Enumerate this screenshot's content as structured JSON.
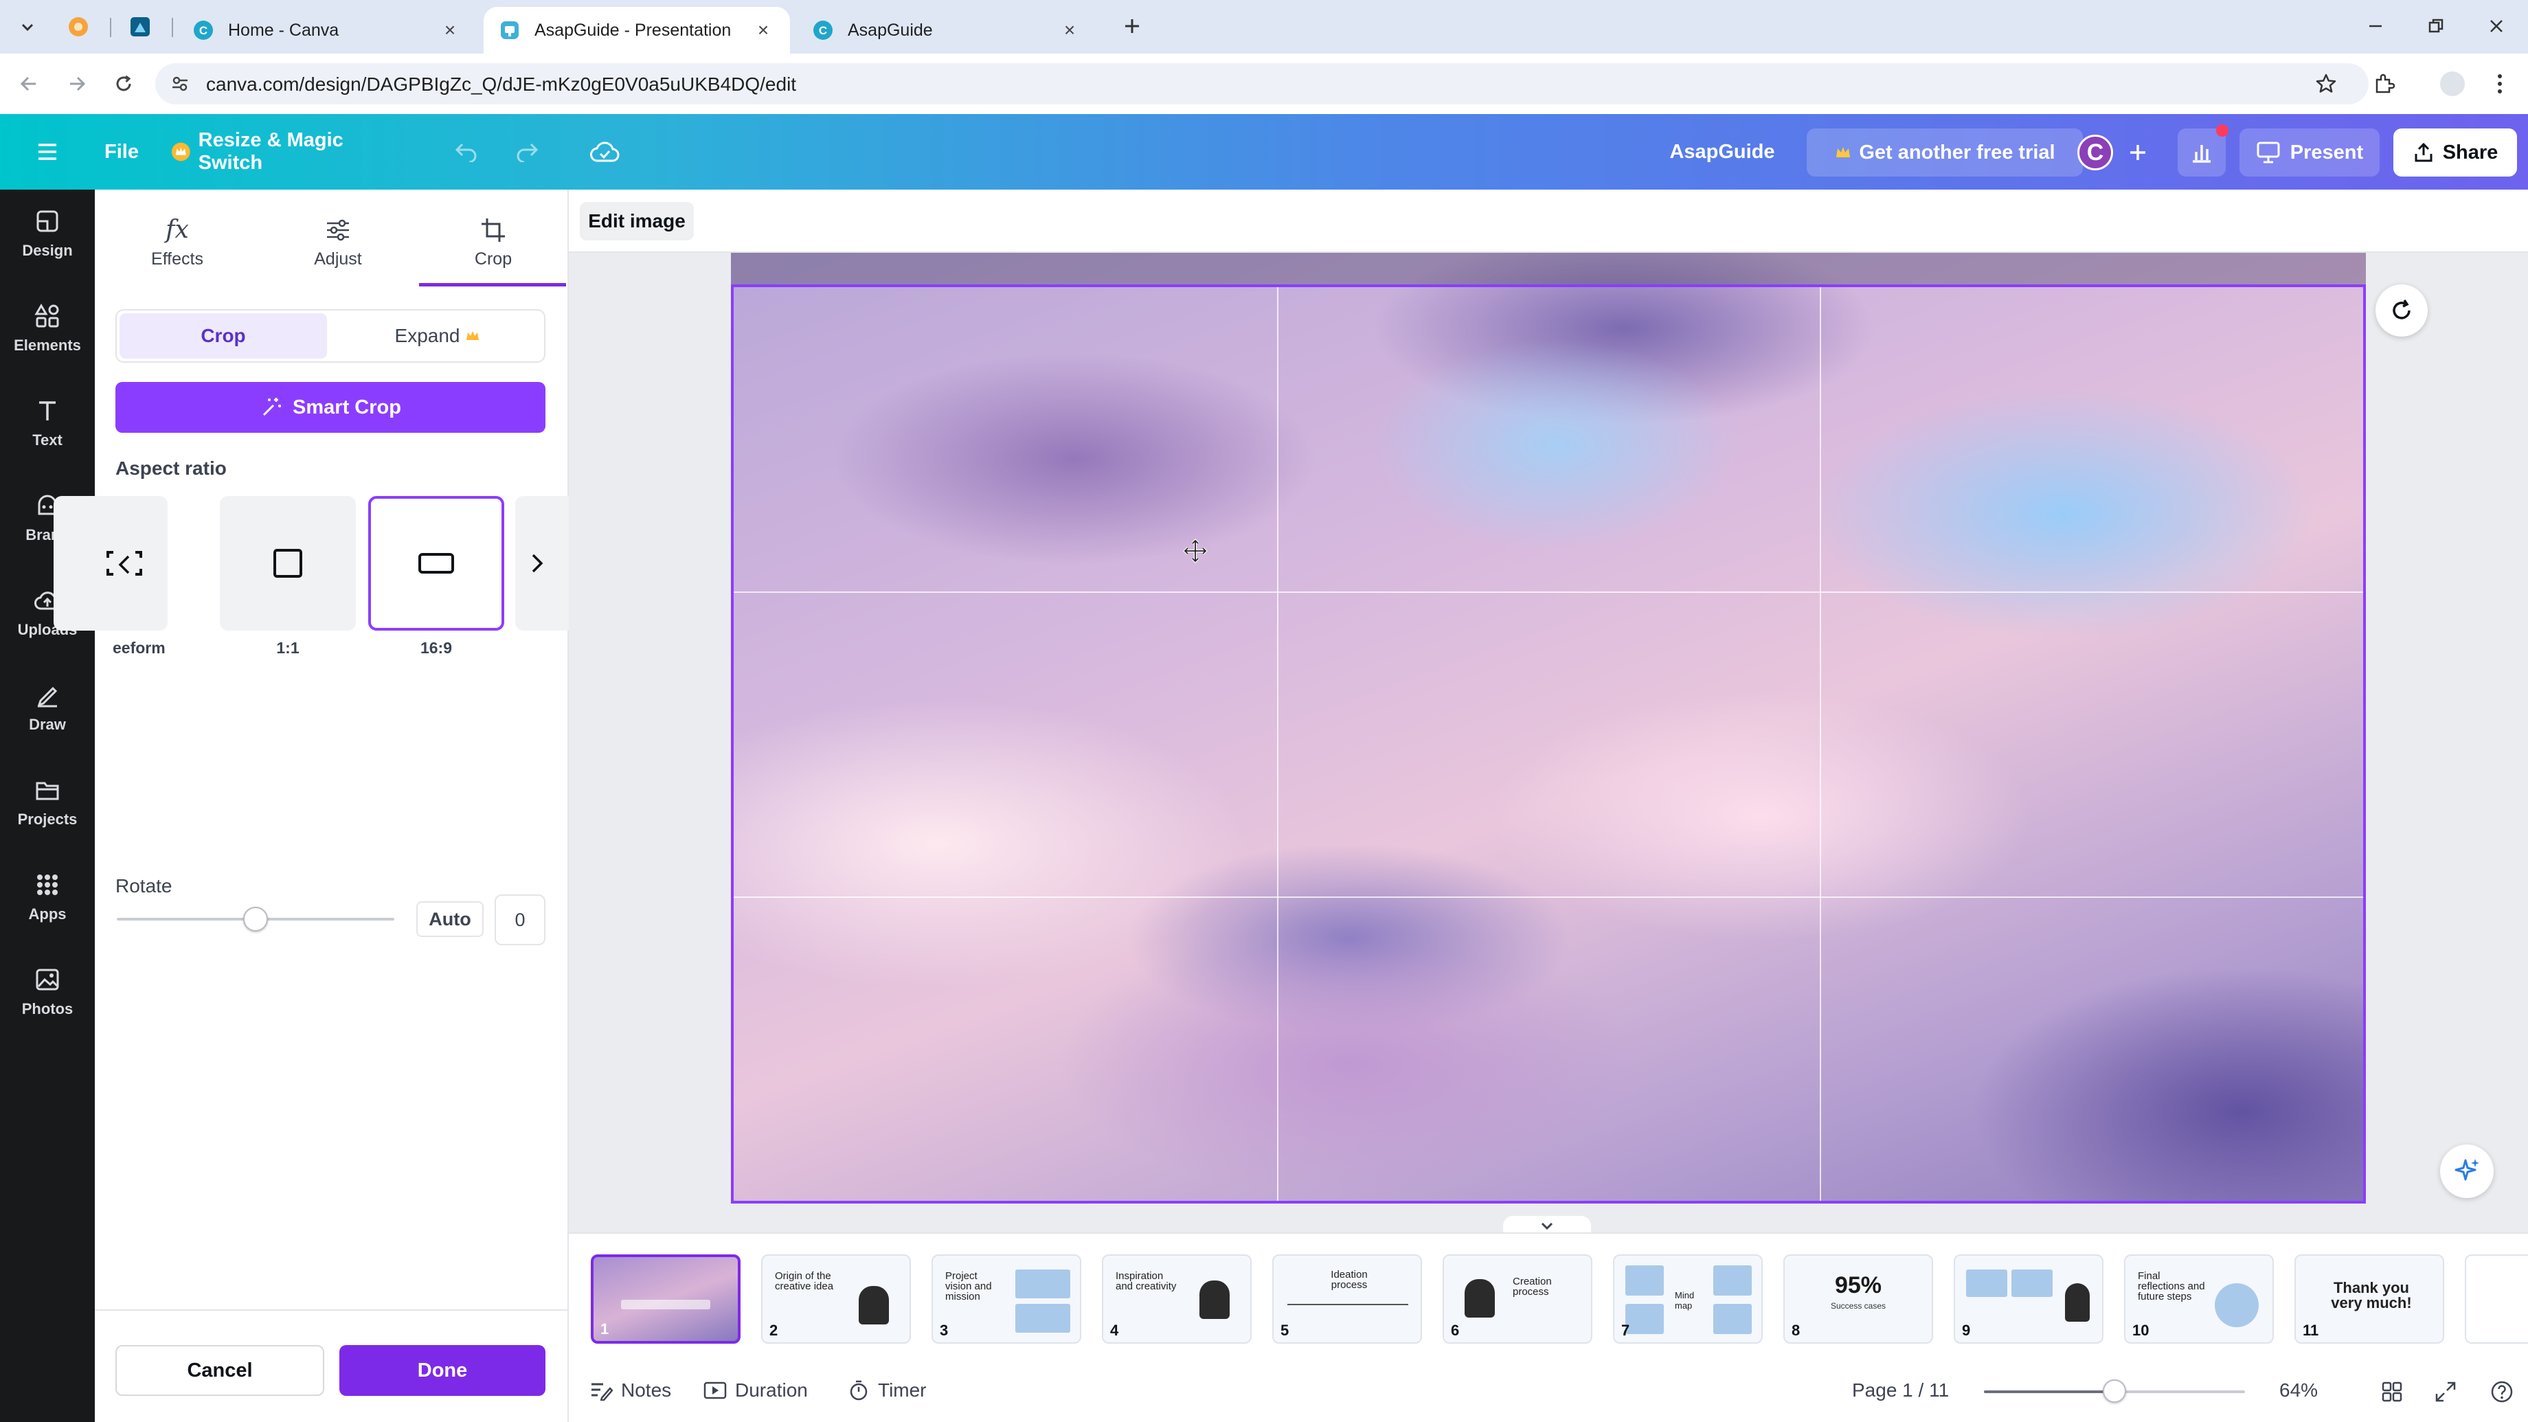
{
  "browser": {
    "tabs": [
      {
        "label": "Home - Canva"
      },
      {
        "label": "AsapGuide - Presentation"
      },
      {
        "label": "AsapGuide"
      }
    ],
    "url": "canva.com/design/DAGPBIgZc_Q/dJE-mKz0gE0V0a5uUKB4DQ/edit"
  },
  "header": {
    "file_label": "File",
    "resize_label": "Resize & Magic Switch",
    "doc_title": "AsapGuide",
    "trial_label": "Get another free trial",
    "avatar_initial": "C",
    "present_label": "Present",
    "share_label": "Share"
  },
  "rail": {
    "items": [
      {
        "label": "Design",
        "icon": "design-icon"
      },
      {
        "label": "Elements",
        "icon": "elements-icon"
      },
      {
        "label": "Text",
        "icon": "text-icon"
      },
      {
        "label": "Brand",
        "icon": "brand-icon"
      },
      {
        "label": "Uploads",
        "icon": "uploads-icon"
      },
      {
        "label": "Draw",
        "icon": "draw-icon"
      },
      {
        "label": "Projects",
        "icon": "projects-icon"
      },
      {
        "label": "Apps",
        "icon": "apps-icon"
      },
      {
        "label": "Photos",
        "icon": "photos-icon"
      }
    ]
  },
  "panel": {
    "tabs": [
      {
        "label": "Effects"
      },
      {
        "label": "Adjust"
      },
      {
        "label": "Crop"
      }
    ],
    "segment": {
      "crop": "Crop",
      "expand": "Expand"
    },
    "smart_crop": "Smart Crop",
    "aspect_ratio_title": "Aspect ratio",
    "ratios": [
      {
        "label": "eeform"
      },
      {
        "label": "1:1"
      },
      {
        "label": "16:9"
      }
    ],
    "rotate_title": "Rotate",
    "rotate_auto": "Auto",
    "rotate_value": "0",
    "rotate_slider_fraction": 0.5,
    "cancel": "Cancel",
    "done": "Done"
  },
  "editor": {
    "edit_image": "Edit image"
  },
  "filmstrip": {
    "slides": [
      {
        "num": "1",
        "title": ""
      },
      {
        "num": "2",
        "title": "Origin of the\ncreative idea"
      },
      {
        "num": "3",
        "title": "Project\nvision and\nmission"
      },
      {
        "num": "4",
        "title": "Inspiration\nand creativity"
      },
      {
        "num": "5",
        "title": "Ideation\nprocess"
      },
      {
        "num": "6",
        "title": "Creation\nprocess"
      },
      {
        "num": "7",
        "title": "Mind\nmap"
      },
      {
        "num": "8",
        "title": "95%",
        "subtitle": "Success cases"
      },
      {
        "num": "9",
        "title": ""
      },
      {
        "num": "10",
        "title": "Final\nreflections and\nfuture steps"
      },
      {
        "num": "11",
        "title": "Thank you\nvery much!"
      }
    ]
  },
  "status": {
    "notes": "Notes",
    "duration": "Duration",
    "timer": "Timer",
    "page": "Page 1 / 11",
    "zoom": "64%",
    "zoom_fraction": 0.5
  },
  "colors": {
    "accent": "#7d2ae8",
    "smart_crop": "#8b3dff",
    "rail_bg": "#18191b"
  }
}
